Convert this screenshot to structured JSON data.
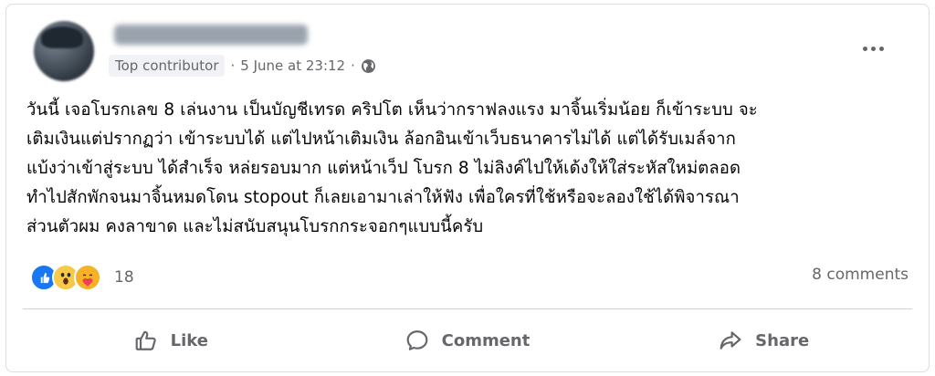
{
  "post": {
    "author_badge": "Top contributor",
    "separator1": "·",
    "timestamp": "5 June at 23:12",
    "separator2": "·",
    "privacy_icon": "globe-icon",
    "text": "วันนี้ เจอโบรกเลข 8 เล่นงาน เป็นบัญชีเทรด คริปโต เห็นว่ากราฟลงแรง มาจิ้นเริ่มน้อย ก็เข้าระบบ จะ\nเติมเงินแต่ปรากฏว่า เข้าระบบได้ แต่ไปหน้าเติมเงิน ล้อกอินเข้าเว็บธนาคารไม่ได้ แต่ได้รับเมล์จาก\nแบ้งว่าเข้าสู่ระบบ ได้สำเร็จ หล่ยรอบมาก แต่หน้าเว็ป โบรก 8 ไม่ลิงค์ไปให้เด้งให้ใส่ระหัสใหม่ตลอด\nทำไปสักพักจนมาจิ้นหมดโดน stopout ก็เลยเอามาเล่าให้ฟัง เพื่อใครที่ใช้หรือจะลองใช้ได้พิจารณา\nส่วนตัวผม คงลาขาด และไม่สนับสนุนโบรกกระจอกๆแบบนี้ครับ"
  },
  "reactions": {
    "icons": [
      "like-reaction-icon",
      "wow-reaction-icon",
      "care-reaction-icon"
    ],
    "count": "18"
  },
  "comments_count": "8 comments",
  "actions": {
    "like_label": "Like",
    "comment_label": "Comment",
    "share_label": "Share"
  },
  "colors": {
    "like_blue": "#1877f2",
    "secondary_text": "#65676b",
    "divider": "#ced0d4"
  }
}
